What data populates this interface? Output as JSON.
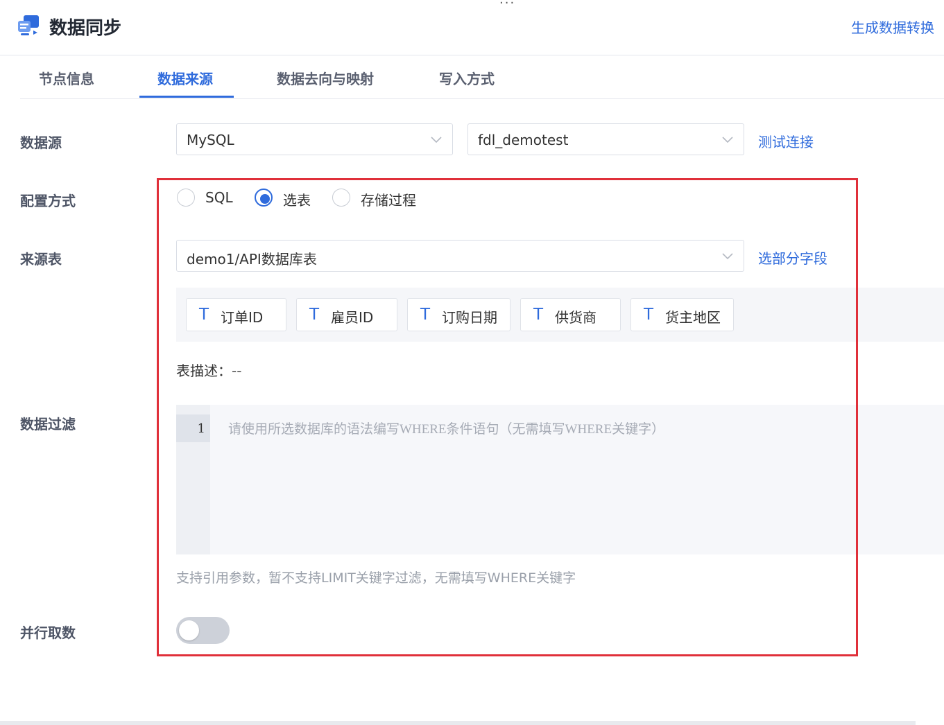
{
  "header": {
    "title": "数据同步",
    "generate_link": "生成数据转换",
    "menu_dots": "···"
  },
  "tabs": [
    {
      "label": "节点信息"
    },
    {
      "label": "数据来源",
      "active": true
    },
    {
      "label": "数据去向与映射"
    },
    {
      "label": "写入方式"
    }
  ],
  "form": {
    "datasource": {
      "label": "数据源",
      "type_value": "MySQL",
      "connection_value": "fdl_demotest",
      "test_link": "测试连接"
    },
    "config_mode": {
      "label": "配置方式",
      "options": [
        {
          "label": "SQL",
          "checked": false
        },
        {
          "label": "选表",
          "checked": true
        },
        {
          "label": "存储过程",
          "checked": false
        }
      ]
    },
    "source_table": {
      "label": "来源表",
      "value": "demo1/API数据库表",
      "select_fields_link": "选部分字段"
    },
    "fields": [
      {
        "icon": "T",
        "name": "订单ID"
      },
      {
        "icon": "T",
        "name": "雇员ID"
      },
      {
        "icon": "T",
        "name": "订购日期"
      },
      {
        "icon": "T",
        "name": "供货商"
      },
      {
        "icon": "T",
        "name": "货主地区"
      }
    ],
    "table_description": {
      "label": "表描述：",
      "value": "--"
    },
    "data_filter": {
      "label": "数据过滤",
      "line_number": "1",
      "placeholder": "请使用所选数据库的语法编写WHERE条件语句（无需填写WHERE关键字）",
      "hint": "支持引用参数，暂不支持LIMIT关键字过滤，无需填写WHERE关键字"
    },
    "parallel_fetch": {
      "label": "并行取数",
      "enabled": false
    }
  },
  "colors": {
    "accent": "#2f6bdc",
    "highlight_border": "#e0303a",
    "toggle_off": "#cdd1d9"
  }
}
